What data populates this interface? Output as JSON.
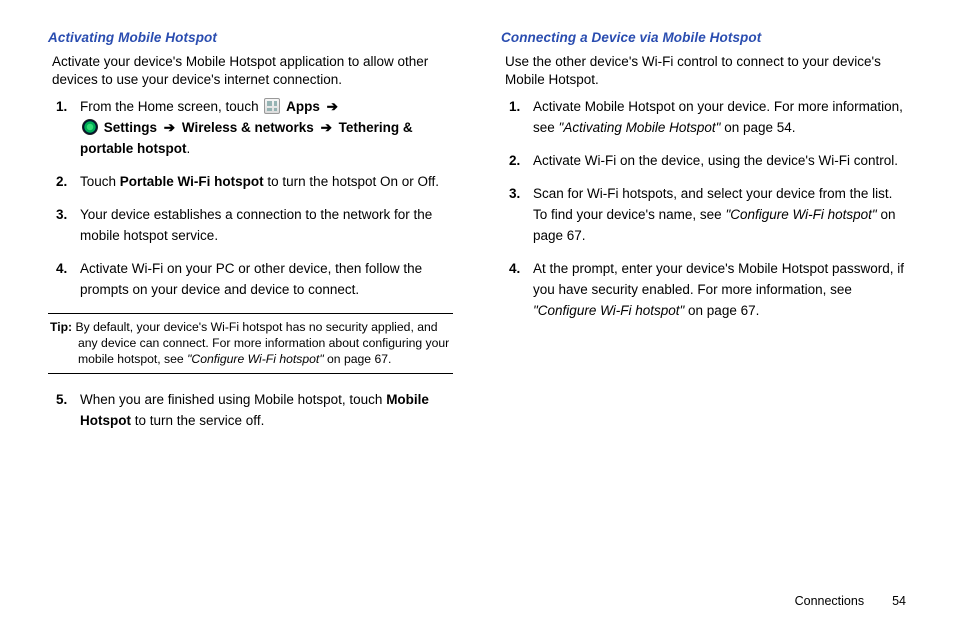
{
  "left": {
    "heading": "Activating Mobile Hotspot",
    "intro": "Activate your device's Mobile Hotspot application to allow other devices to use your device's internet connection.",
    "step1_pre": "From the Home screen, touch ",
    "icon_apps_label": "Apps",
    "step1_settings": "Settings",
    "step1_path": "Wireless & networks",
    "step1_path2": "Tethering & portable hotspot",
    "step1_end": ".",
    "step2a": "Touch ",
    "step2b": "Portable Wi-Fi hotspot",
    "step2c": " to turn the hotspot On or Off.",
    "step3": "Your device establishes a connection to the network for the mobile hotspot service.",
    "step4": "Activate Wi-Fi on your PC or other device, then follow the prompts on your device and device to connect.",
    "tip_label": "Tip:",
    "tip_body_a": " By default, your device's Wi-Fi hotspot has no security applied, and any device can connect. For more information about configuring your mobile hotspot, see ",
    "tip_xref": "\"Configure Wi-Fi hotspot\"",
    "tip_body_b": " on page 67.",
    "step5a": "When you are finished using Mobile hotspot, touch ",
    "step5b": "Mobile Hotspot",
    "step5c": " to turn the service off."
  },
  "right": {
    "heading": "Connecting a Device via Mobile Hotspot",
    "intro": "Use the other device's Wi-Fi control to connect to your device's Mobile Hotspot.",
    "r1a": "Activate Mobile Hotspot on your device. For more information, see ",
    "r1b": "\"Activating Mobile Hotspot\"",
    "r1c": " on page 54.",
    "r2": "Activate Wi-Fi on the device, using the device's Wi-Fi control.",
    "r3a": "Scan for Wi-Fi hotspots, and select your device from the list. To find your device's name, see ",
    "r3b": "\"Configure Wi-Fi hotspot\"",
    "r3c": " on page 67.",
    "r4a": "At the prompt, enter your device's Mobile Hotspot password, if you have security enabled. For more information, see ",
    "r4b": "\"Configure Wi-Fi hotspot\"",
    "r4c": " on page 67."
  },
  "footer": {
    "section": "Connections",
    "page": "54"
  },
  "arrow": "➔"
}
